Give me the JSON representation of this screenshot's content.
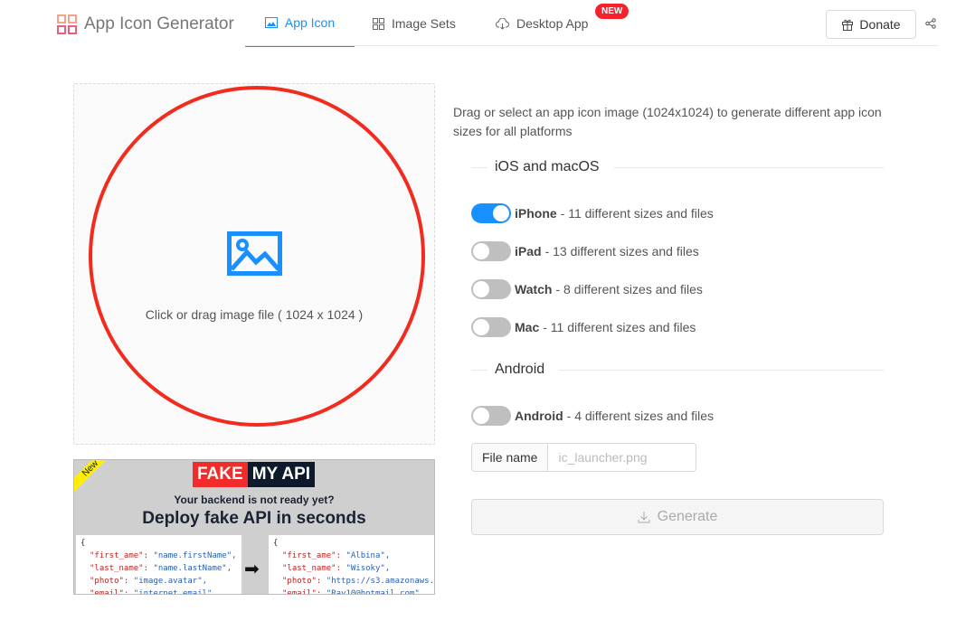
{
  "header": {
    "app_title": "App Icon Generator",
    "tabs": [
      {
        "label": "App Icon",
        "icon": "picture-icon"
      },
      {
        "label": "Image Sets",
        "icon": "grid-icon"
      },
      {
        "label": "Desktop App",
        "icon": "cloud-download-icon"
      }
    ],
    "new_badge": "NEW",
    "donate": "Donate"
  },
  "upload": {
    "hint": "Click or drag image file ( 1024 x 1024 )"
  },
  "ad": {
    "ribbon": "New",
    "brand_a": "FAKE",
    "brand_b": "MY API",
    "subtitle": "Your backend is not ready yet?",
    "title": "Deploy fake API in seconds",
    "left_code": [
      [
        "{",
        ""
      ],
      [
        "\"first_ame\": ",
        "\"name.firstName\","
      ],
      [
        "\"last_name\": ",
        "\"name.lastName\","
      ],
      [
        "\"photo\": ",
        "\"image.avatar\","
      ],
      [
        "\"email\": ",
        "\"internet.email\","
      ]
    ],
    "right_code": [
      [
        "{",
        ""
      ],
      [
        "\"first_ame\": ",
        "\"Albina\","
      ],
      [
        "\"last_name\": ",
        "\"Wisoky\","
      ],
      [
        "\"photo\": ",
        "\"https://s3.amazonaws.\""
      ],
      [
        "\"email\": ",
        "\"Ray10@hotmail.com\","
      ]
    ]
  },
  "main": {
    "description": "Drag or select an app icon image (1024x1024) to generate different app icon sizes for all platforms",
    "sections": [
      {
        "title": "iOS and macOS"
      },
      {
        "title": "Android"
      }
    ],
    "options": [
      {
        "name": "iPhone",
        "detail": "- 11 different sizes and files",
        "on": true
      },
      {
        "name": "iPad",
        "detail": "- 13 different sizes and files",
        "on": false
      },
      {
        "name": "Watch",
        "detail": "- 8 different sizes and files",
        "on": false
      },
      {
        "name": "Mac",
        "detail": "- 11 different sizes and files",
        "on": false
      },
      {
        "name": "Android",
        "detail": "- 4 different sizes and files",
        "on": false
      }
    ],
    "file_label": "File name",
    "file_placeholder": "ic_launcher.png",
    "generate": "Generate"
  },
  "colors": {
    "accent": "#1890ff",
    "annotation": "#f22b1f",
    "badge": "#f5222d"
  }
}
